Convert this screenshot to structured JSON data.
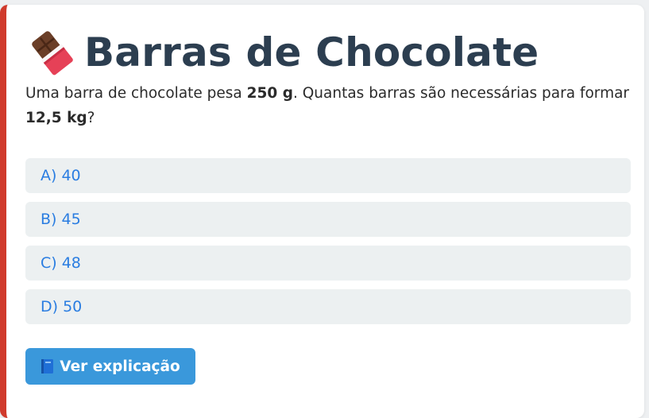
{
  "card": {
    "title": "Barras de Chocolate",
    "title_icon": "chocolate-bar-icon",
    "question": {
      "part1": "Uma barra de chocolate pesa ",
      "bold1": "250 g",
      "part2": ". Quantas barras são necessárias para formar ",
      "bold2": "12,5 kg",
      "part3": "?"
    },
    "options": [
      {
        "label": "A) 40"
      },
      {
        "label": "B) 45"
      },
      {
        "label": "C) 48"
      },
      {
        "label": "D) 50"
      }
    ],
    "explain_button": {
      "icon": "book-icon",
      "label": "Ver explicação"
    }
  },
  "colors": {
    "accent_border": "#d03a2c",
    "title": "#2c3e50",
    "option_bg": "#ecf0f1",
    "option_text": "#2a7de1",
    "button_bg": "#3a98db"
  }
}
